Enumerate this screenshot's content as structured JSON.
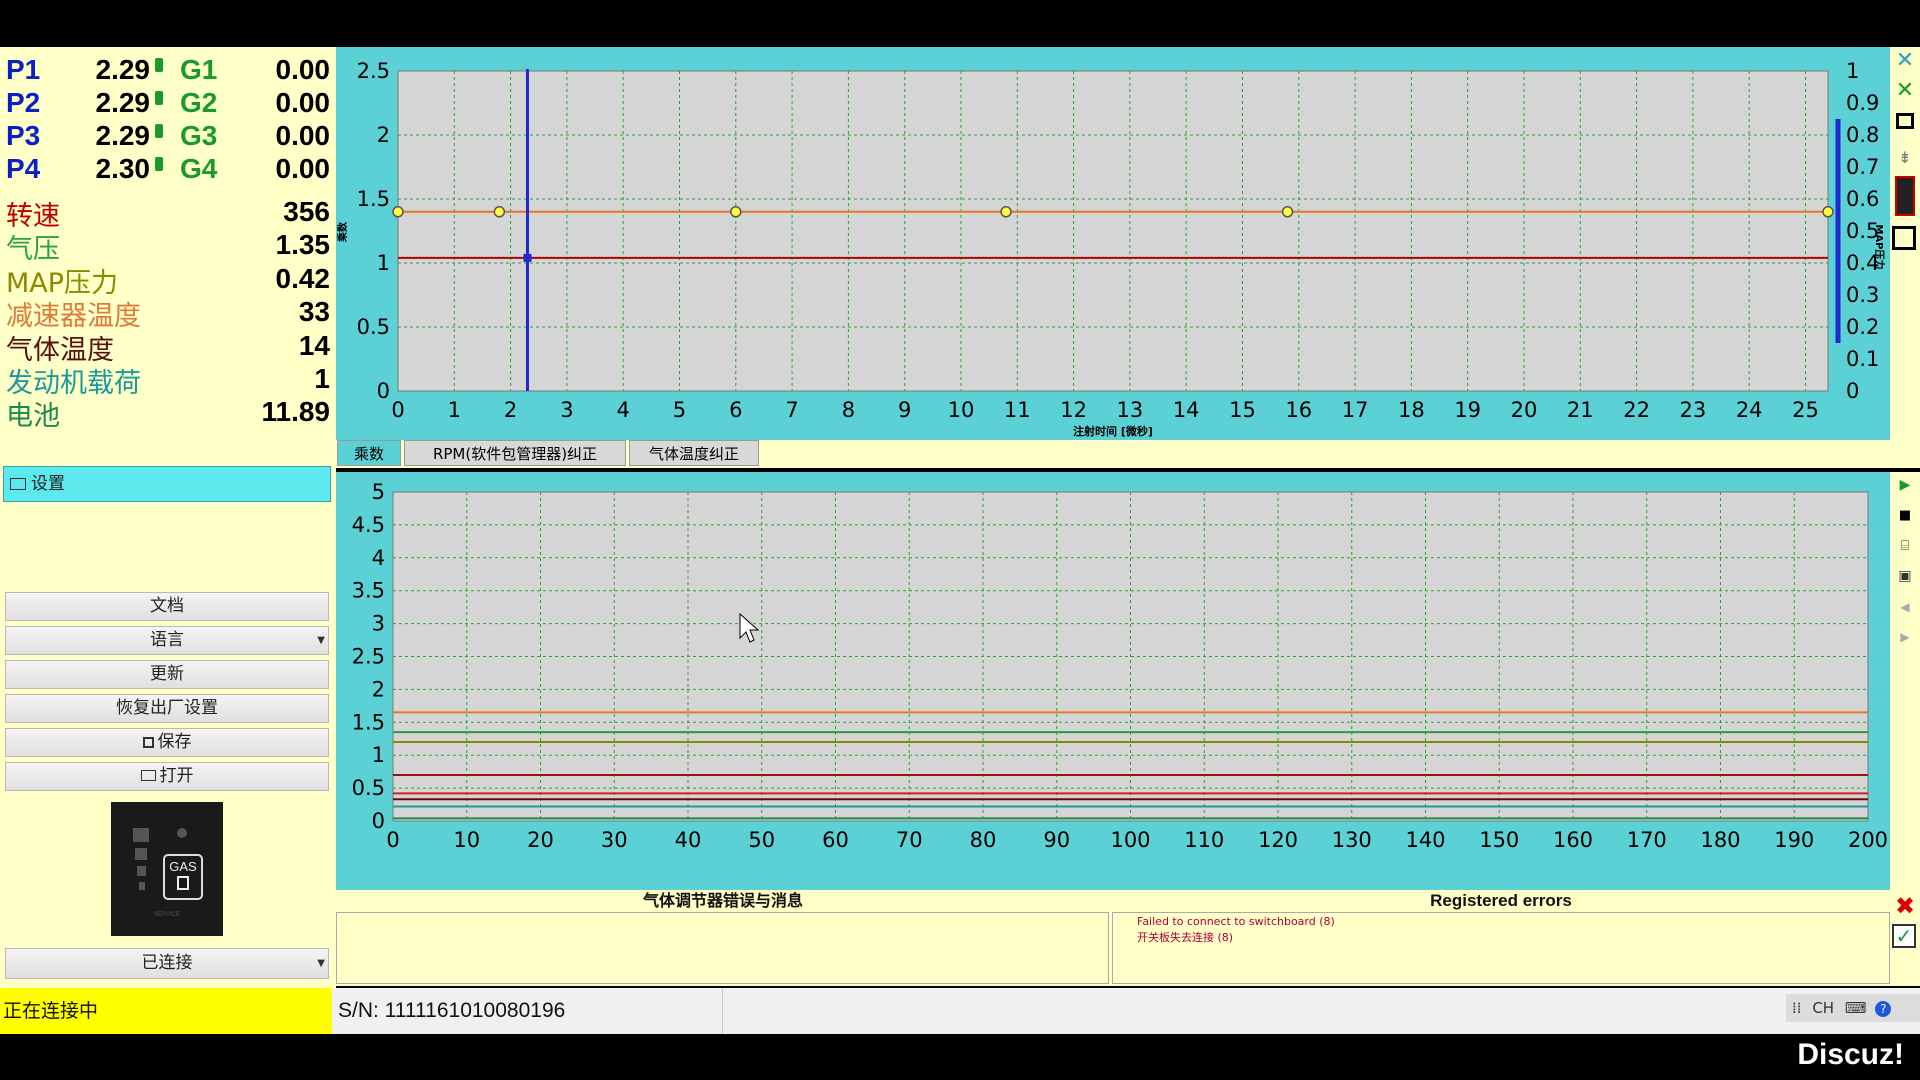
{
  "readouts": {
    "pressure": [
      {
        "label": "P1",
        "value": "2.29",
        "glabel": "G1",
        "gvalue": "0.00"
      },
      {
        "label": "P2",
        "value": "2.29",
        "glabel": "G2",
        "gvalue": "0.00"
      },
      {
        "label": "P3",
        "value": "2.29",
        "glabel": "G3",
        "gvalue": "0.00"
      },
      {
        "label": "P4",
        "value": "2.30",
        "glabel": "G4",
        "gvalue": "0.00"
      }
    ],
    "engine": [
      {
        "label": "转速",
        "value": "356",
        "color": "#c00000"
      },
      {
        "label": "气压",
        "value": "1.35",
        "color": "#2aa24a"
      },
      {
        "label": "MAP压力",
        "value": "0.42",
        "color": "#8a8a00"
      },
      {
        "label": "减速器温度",
        "value": "33",
        "color": "#e07a3a"
      },
      {
        "label": "气体温度",
        "value": "14",
        "color": "#5a1010"
      },
      {
        "label": "发动机载荷",
        "value": "1",
        "color": "#1a9aa0"
      },
      {
        "label": "电池",
        "value": "11.89",
        "color": "#1a8a50"
      }
    ]
  },
  "tree": {
    "settings_label": "设置"
  },
  "left_menu": {
    "documents": "文档",
    "language": "语言",
    "update": "更新",
    "factory_reset": "恢复出厂设置",
    "save": "保存",
    "open": "打开",
    "connection_state": "已连接",
    "gas_logo": "GAS",
    "gas_logo_sub": "SERVICE"
  },
  "top_chart": {
    "xlabel": "注射时间 [微秒]",
    "ylabel": "乘数",
    "y2label": "MAP压力",
    "y_ticks": [
      "2.5",
      "2",
      "1.5",
      "1",
      "0.5",
      "0"
    ],
    "y2_ticks": [
      "1",
      "0.9",
      "0.8",
      "0.7",
      "0.6",
      "0.5",
      "0.4",
      "0.3",
      "0.2",
      "0.1",
      "0"
    ],
    "x_ticks": [
      "0",
      "1",
      "2",
      "3",
      "4",
      "5",
      "6",
      "7",
      "8",
      "9",
      "10",
      "11",
      "12",
      "13",
      "14",
      "15",
      "16",
      "17",
      "18",
      "19",
      "20",
      "21",
      "22",
      "23",
      "24",
      "25"
    ],
    "xlim": [
      0,
      25.4
    ],
    "ylim": [
      0,
      2.5
    ],
    "y2lim": [
      0,
      1
    ],
    "orange_line": {
      "y": 1.4,
      "points_x": [
        0,
        1.8,
        6,
        10.8,
        15.8,
        25.4
      ],
      "color": "#e0772b"
    },
    "red_line": {
      "y": 1.04,
      "color": "#b00000"
    },
    "cursor_x": 2.3,
    "map_bar": {
      "from": 0.15,
      "to": 0.85,
      "color": "#1e2ad0"
    }
  },
  "tabs": [
    {
      "label": "乘数",
      "active": true
    },
    {
      "label": "RPM(软件包管理器)纠正",
      "active": false
    },
    {
      "label": "气体温度纠正",
      "active": false
    }
  ],
  "bottom_chart": {
    "y_ticks": [
      "5",
      "4.5",
      "4",
      "3.5",
      "3",
      "2.5",
      "2",
      "1.5",
      "1",
      "0.5",
      "0"
    ],
    "x_ticks": [
      "0",
      "10",
      "20",
      "30",
      "40",
      "50",
      "60",
      "70",
      "80",
      "90",
      "100",
      "110",
      "120",
      "130",
      "140",
      "150",
      "160",
      "170",
      "180",
      "190",
      "200"
    ],
    "xlim": [
      0,
      200
    ],
    "ylim": [
      0,
      5
    ],
    "lines": [
      {
        "y": 1.65,
        "color": "#e0772b"
      },
      {
        "y": 1.35,
        "color": "#2a9a3a"
      },
      {
        "y": 1.2,
        "color": "#8a8a00"
      },
      {
        "y": 0.7,
        "color": "#a01010"
      },
      {
        "y": 0.42,
        "color": "#d02020"
      },
      {
        "y": 0.33,
        "color": "#6a0a0a"
      },
      {
        "y": 0.22,
        "color": "#1a9aa0"
      },
      {
        "y": 0.04,
        "color": "#1a8a50"
      }
    ]
  },
  "messages": {
    "left_title": "气体调节器错误与消息",
    "right_title": "Registered errors",
    "errors": [
      "Failed to connect to switchboard (8)",
      "开关板失去连接 (8)"
    ]
  },
  "status": {
    "left": "正在连接中",
    "serial": "S/N: 1111161010080196",
    "lang_indicator": "CH"
  },
  "watermark": "Discuz!"
}
